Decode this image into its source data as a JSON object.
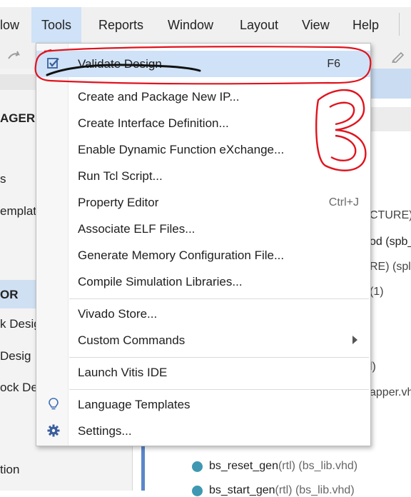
{
  "menubar": {
    "items": [
      {
        "label": "low"
      },
      {
        "label": "Tools"
      },
      {
        "label": "Reports"
      },
      {
        "label": "Window"
      },
      {
        "label": "Layout"
      },
      {
        "label": "View"
      },
      {
        "label": "Help"
      }
    ]
  },
  "left_panel": {
    "lines": [
      "AGER",
      "s",
      "emplat",
      "OR",
      "k Desig",
      "Desig",
      "ock De",
      "tion"
    ]
  },
  "right_pane": {
    "lines": [
      "CTURE)",
      "od (spb_",
      "RE) (spl",
      "(1)",
      "l)",
      "apper.vh"
    ],
    "tree_items": [
      {
        "name": "bs_reset_gen",
        "arch": "(rtl)",
        "file": "(bs_lib.vhd)"
      },
      {
        "name": "bs_start_gen",
        "arch": "(rtl)",
        "file": "(bs_lib.vhd)"
      }
    ]
  },
  "tools_menu": {
    "items": [
      {
        "label": "Validate Design",
        "shortcut": "F6",
        "icon": "validate-check-icon"
      },
      {
        "label": "Create and Package New IP..."
      },
      {
        "label": "Create Interface Definition..."
      },
      {
        "label": "Enable Dynamic Function eXchange..."
      },
      {
        "label": "Run Tcl Script..."
      },
      {
        "label": "Property Editor",
        "shortcut": "Ctrl+J"
      },
      {
        "label": "Associate ELF Files..."
      },
      {
        "label": "Generate Memory Configuration File..."
      },
      {
        "label": "Compile Simulation Libraries..."
      },
      {
        "label": "Vivado Store..."
      },
      {
        "label": "Custom Commands",
        "submenu": "chevron-right-icon"
      },
      {
        "label": "Launch Vitis IDE"
      },
      {
        "label": "Language Templates",
        "icon": "lightbulb-icon"
      },
      {
        "label": "Settings...",
        "icon": "gear-icon"
      }
    ]
  },
  "annotation": {
    "number": "3",
    "color": "#e0141e"
  },
  "colors": {
    "highlight": "#cfe2f7",
    "accent": "#5b87c9",
    "tree_dot": "#3e98b2"
  }
}
